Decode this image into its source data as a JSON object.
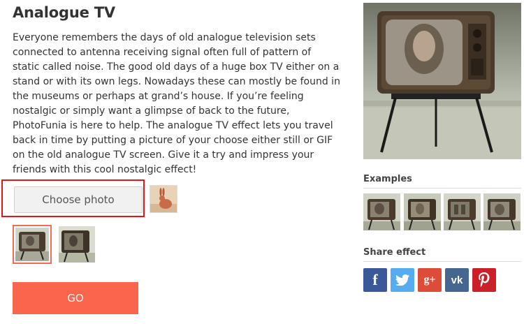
{
  "effect": {
    "title": "Analogue TV",
    "description": "Everyone remembers the days of old analogue television sets connected to antenna receiving signal often full of pattern of static called noise. The good old days of a huge box TV either on a stand or with its own legs. Nowadays these can mostly be found in the museums or perhaps at grand’s house. If you’re feeling nostalgic or simply want a glimpse of back to the future, PhotoFunia is here to help. The analogue TV effect lets you travel back in time by putting a picture of your choose either still or GIF on the old analogue TV screen. Give it a try and impress your friends with this cool nostalgic effect!"
  },
  "upload": {
    "choose_label": "Choose photo",
    "recent_photo_icon": "rabbit-photo-thumbnail"
  },
  "variants": [
    {
      "icon": "tv-variant-1-thumbnail",
      "selected": true
    },
    {
      "icon": "tv-variant-2-thumbnail",
      "selected": false
    }
  ],
  "go_label": "GO",
  "sidebar": {
    "examples_label": "Examples",
    "share_label": "Share effect",
    "examples_count": 4,
    "share": [
      {
        "name": "facebook",
        "glyph": "f",
        "color": "#3b5998"
      },
      {
        "name": "twitter",
        "glyph": "t",
        "color": "#55acee"
      },
      {
        "name": "google-plus",
        "glyph": "g+",
        "color": "#dd4b39"
      },
      {
        "name": "vk",
        "glyph": "vk",
        "color": "#45668e"
      },
      {
        "name": "pinterest",
        "glyph": "p",
        "color": "#cb2027"
      }
    ]
  },
  "colors": {
    "accent": "#f9664d",
    "highlight_border": "#e3151b"
  }
}
